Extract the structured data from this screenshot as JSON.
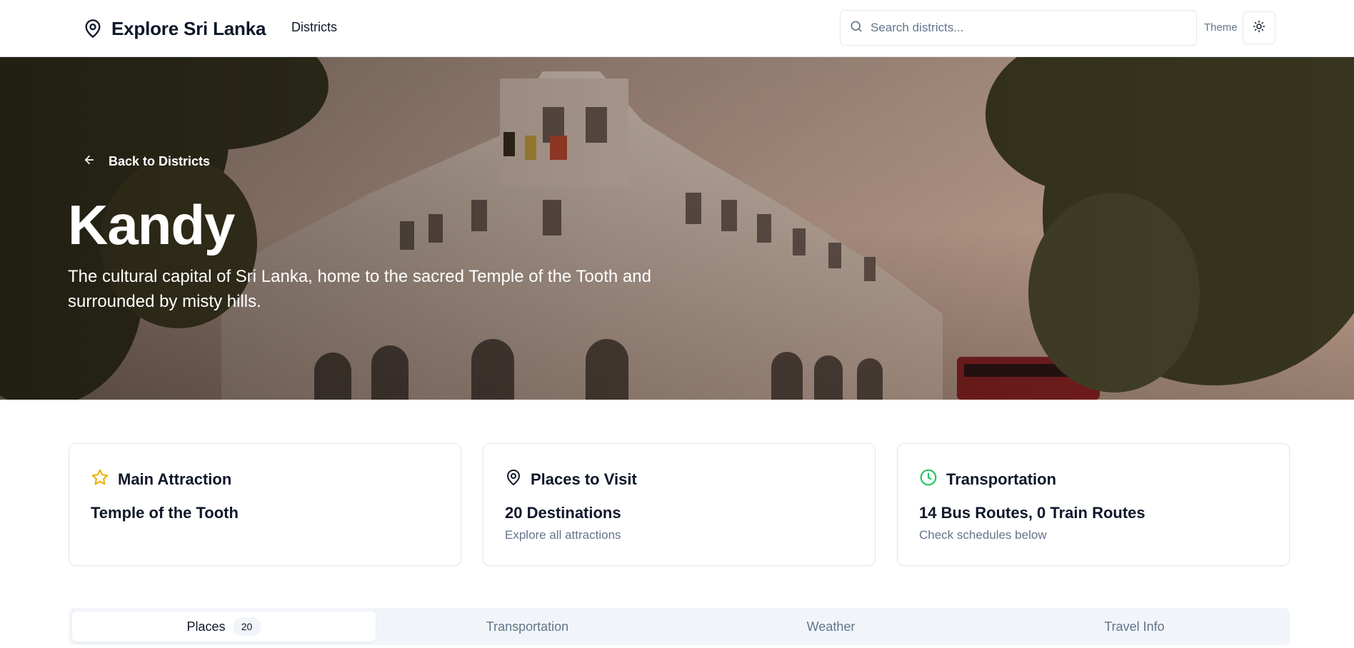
{
  "header": {
    "brand_title": "Explore Sri Lanka",
    "nav_districts": "Districts",
    "search_placeholder": "Search districts...",
    "theme_label": "Theme"
  },
  "hero": {
    "back_label": "Back to Districts",
    "title": "Kandy",
    "description": "The cultural capital of Sri Lanka, home to the sacred Temple of the Tooth and surrounded by misty hills."
  },
  "cards": [
    {
      "icon": "star-icon",
      "title": "Main Attraction",
      "value": "Temple of the Tooth",
      "sub": "",
      "icon_color": "#eab308"
    },
    {
      "icon": "map-pin-icon",
      "title": "Places to Visit",
      "value": "20 Destinations",
      "sub": "Explore all attractions",
      "icon_color": "#0f172a"
    },
    {
      "icon": "clock-icon",
      "title": "Transportation",
      "value": "14 Bus Routes, 0 Train Routes",
      "sub": "Check schedules below",
      "icon_color": "#22c55e"
    }
  ],
  "tabs": [
    {
      "label": "Places",
      "badge": "20",
      "active": true
    },
    {
      "label": "Transportation",
      "active": false
    },
    {
      "label": "Weather",
      "active": false
    },
    {
      "label": "Travel Info",
      "active": false
    }
  ]
}
